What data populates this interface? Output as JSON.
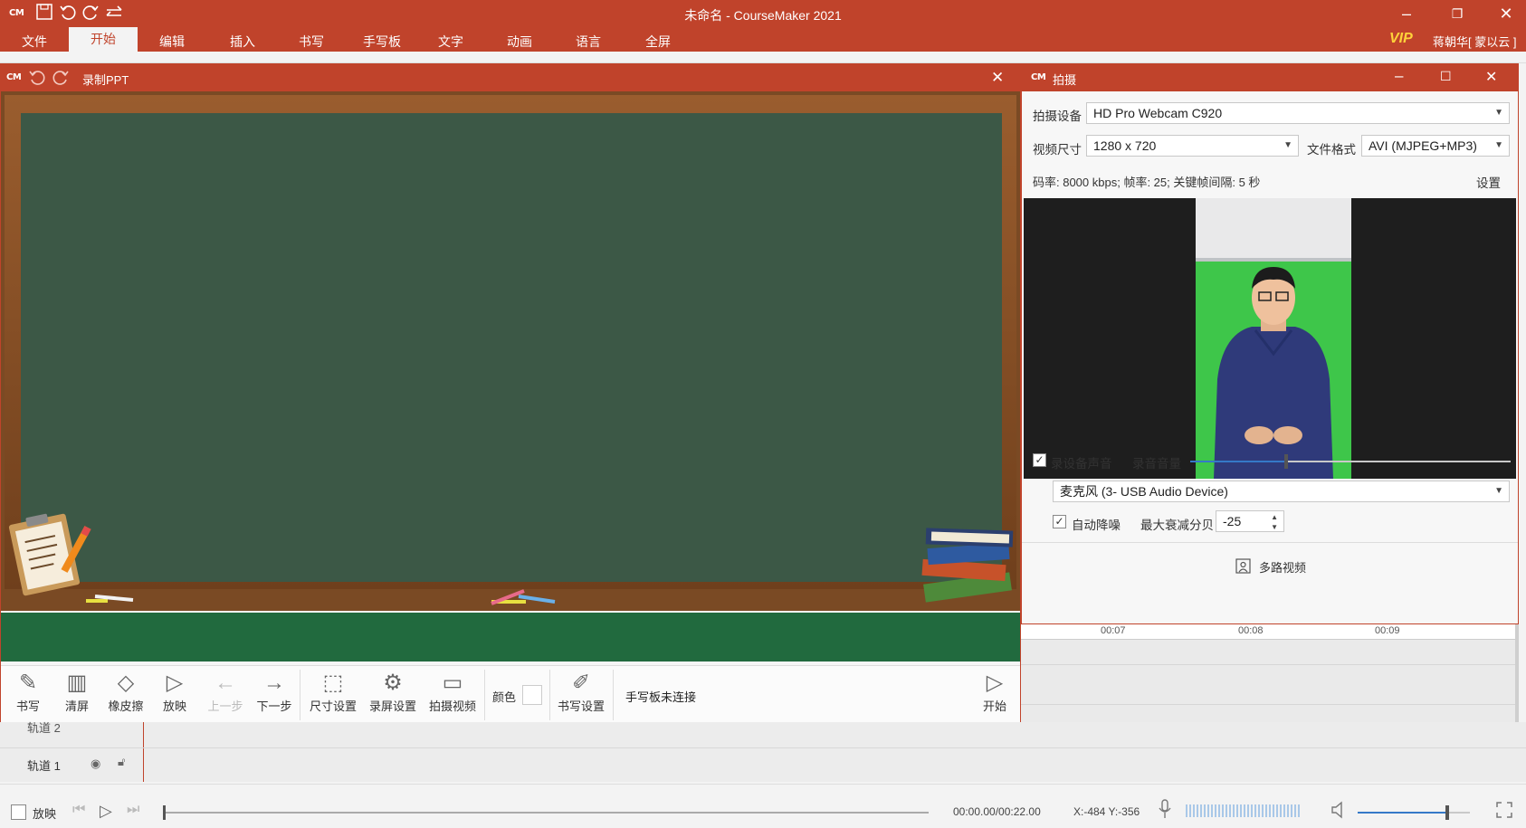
{
  "app": {
    "logo": "CM",
    "title": "未命名 - CourseMaker 2021",
    "vip": "VIP",
    "user": "蒋朝华[ 蒙以云 ]"
  },
  "menu": [
    "文件",
    "开始",
    "编辑",
    "插入",
    "书写",
    "手写板",
    "文字",
    "动画",
    "语言",
    "全屏"
  ],
  "record_window": {
    "logo": "CM",
    "title": "录制PPT",
    "tools": [
      {
        "label": "书写",
        "icon": "pen-icon"
      },
      {
        "label": "清屏",
        "icon": "broom-icon"
      },
      {
        "label": "橡皮擦",
        "icon": "eraser-icon"
      },
      {
        "label": "放映",
        "icon": "play-screen-icon"
      },
      {
        "label": "上一步",
        "icon": "arrow-left-icon"
      },
      {
        "label": "下一步",
        "icon": "arrow-right-icon"
      },
      {
        "label": "尺寸设置",
        "icon": "frame-icon"
      },
      {
        "label": "录屏设置",
        "icon": "gear-icon"
      },
      {
        "label": "拍摄视频",
        "icon": "camera-icon"
      }
    ],
    "color_label": "颜色",
    "pen_settings": "书写设置",
    "tablet_status": "手写板未连接",
    "start": "开始"
  },
  "capture_window": {
    "logo": "CM",
    "title": "拍摄",
    "device_label": "拍摄设备",
    "device_value": "HD Pro Webcam C920",
    "size_label": "视频尺寸",
    "size_value": "1280 x 720",
    "format_label": "文件格式",
    "format_value": "AVI (MJPEG+MP3)",
    "bitrate_info": "码率: 8000 kbps; 帧率: 25; 关键帧间隔: 5 秒",
    "settings_link": "设置",
    "record_audio_label": "录设备声音",
    "record_audio_checked": true,
    "volume_label": "录音音量",
    "volume_level": 0.3,
    "mic_value": "麦克风 (3- USB Audio Device)",
    "denoise_label": "自动降噪",
    "denoise_checked": true,
    "max_atten_label": "最大衰减分贝",
    "max_atten_value": "-25",
    "multi_video": "多路视频"
  },
  "timeline": {
    "ticks": [
      "00:07",
      "00:08",
      "00:09"
    ],
    "tracks": [
      "轨道 2",
      "轨道 1"
    ]
  },
  "bottom": {
    "play_label": "放映",
    "time": "00:00.00/00:22.00",
    "coords": "X:-484 Y:-356",
    "volume_level": 0.8
  },
  "colors": {
    "accent": "#c0432b",
    "board": "#3c5846",
    "floor": "#216a3e",
    "green_screen": "#3ec64a",
    "shirt": "#2f3a7a"
  }
}
